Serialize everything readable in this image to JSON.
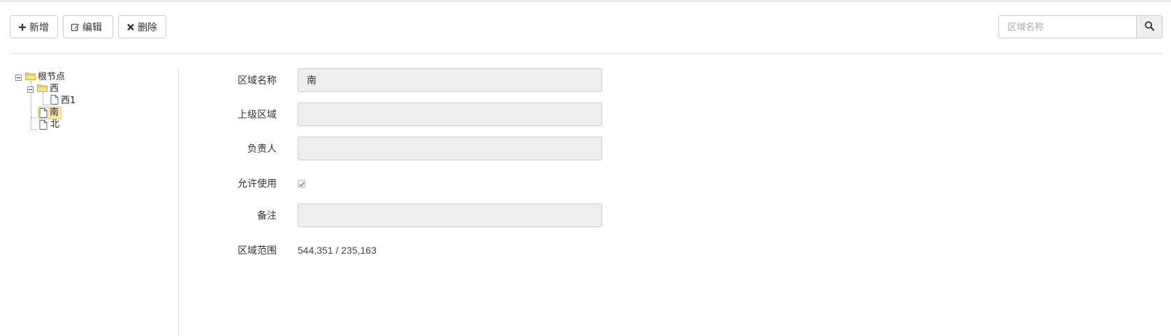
{
  "toolbar": {
    "add_label": "新增",
    "edit_label": "编辑",
    "delete_label": "删除"
  },
  "search": {
    "placeholder": "区域名称",
    "value": ""
  },
  "tree": {
    "nodes": [
      {
        "label": "根节点",
        "type": "folder",
        "expanded": true
      },
      {
        "label": "西",
        "type": "folder",
        "expanded": true
      },
      {
        "label": "西1",
        "type": "file"
      },
      {
        "label": "南",
        "type": "file",
        "selected": true
      },
      {
        "label": "北",
        "type": "file"
      }
    ]
  },
  "form": {
    "name_label": "区域名称",
    "name_value": "南",
    "parent_label": "上级区域",
    "parent_value": "",
    "owner_label": "负责人",
    "owner_value": "",
    "enabled_label": "允许使用",
    "enabled_checked": true,
    "remark_label": "备注",
    "remark_value": "",
    "range_label": "区域范围",
    "range_value": "544,351 / 235,163"
  },
  "colors": {
    "selected_bg": "#ffe6b0",
    "field_bg": "#eeeeee",
    "folder": "#f3c957"
  }
}
